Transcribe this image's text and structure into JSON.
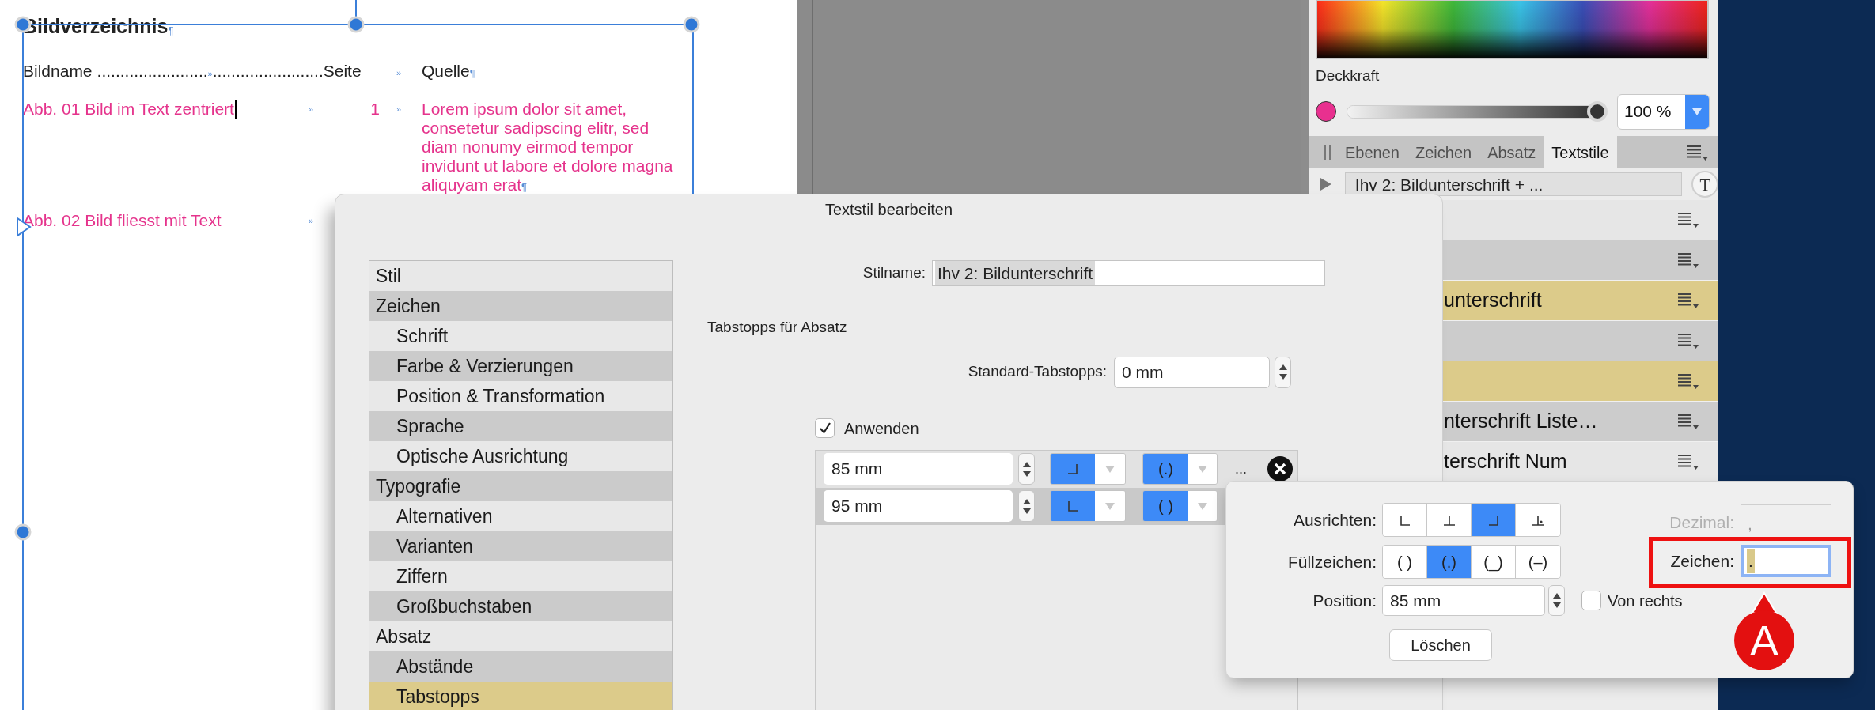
{
  "document": {
    "title": "Bildverzeichnis",
    "title_mark": "¶",
    "header": {
      "name": "Bildname",
      "leader_before": "........................",
      "tab_mark": "»",
      "leader_after": "........................",
      "page": "Seite",
      "page_tab_mark": "»",
      "source": "Quelle",
      "end_mark": "¶"
    },
    "entries": [
      {
        "name": "Abb. 01 Bild im Text zentriert",
        "cursor": true,
        "tab_mark": "»",
        "page": "1",
        "page_tab_mark": "»",
        "source_lines": [
          "Lorem ipsum dolor sit amet,",
          "consetetur sadipscing elitr, sed",
          "diam nonumy eirmod tempor",
          "invidunt ut labore et dolore magna",
          "aliquyam erat"
        ],
        "end_mark": "¶"
      },
      {
        "name": "Abb. 02 Bild fliesst mit Text",
        "cursor": false,
        "tab_mark": "»"
      }
    ]
  },
  "color_panel": {
    "opacity_label": "Deckkraft",
    "color": "#e8308f",
    "level": 1,
    "opacity_value": "100 %"
  },
  "panel_tabs": [
    {
      "label": "Ebenen",
      "selected": false
    },
    {
      "label": "Zeichen",
      "selected": false
    },
    {
      "label": "Absatz",
      "selected": false
    },
    {
      "label": "Textstile",
      "selected": true
    }
  ],
  "style_selector": {
    "value": "Ihv 2: Bildunterschrift + ...",
    "icon_letter": "T"
  },
  "style_rows": [
    {
      "highlighted": false
    },
    {
      "highlighted": false
    },
    {
      "text": "unterschrift",
      "highlighted": true
    },
    {
      "highlighted": false
    },
    {
      "highlighted": true
    },
    {
      "text": "nterschrift Liste…",
      "highlighted": false
    },
    {
      "text": "terschrift Num",
      "highlighted": false
    }
  ],
  "dialog": {
    "title": "Textstil bearbeiten",
    "categories": [
      {
        "label": "Stil",
        "selected": false
      },
      {
        "label": "Zeichen",
        "selected": false,
        "children": [
          {
            "label": "Schrift",
            "selected": false
          },
          {
            "label": "Farbe & Verzierungen",
            "selected": false
          },
          {
            "label": "Position & Transformation",
            "selected": false
          },
          {
            "label": "Sprache",
            "selected": false
          },
          {
            "label": "Optische Ausrichtung",
            "selected": false
          }
        ]
      },
      {
        "label": "Typografie",
        "selected": false,
        "children": [
          {
            "label": "Alternativen",
            "selected": false
          },
          {
            "label": "Varianten",
            "selected": false
          },
          {
            "label": "Ziffern",
            "selected": false
          },
          {
            "label": "Großbuchstaben",
            "selected": false
          }
        ]
      },
      {
        "label": "Absatz",
        "selected": false,
        "children": [
          {
            "label": "Abstände",
            "selected": false
          },
          {
            "label": "Tabstopps",
            "selected": true
          }
        ]
      }
    ],
    "style_name_label": "Stilname:",
    "style_name": "Ihv 2: Bildunterschrift",
    "section_title": "Tabstopps für Absatz",
    "default_tabs_label": "Standard-Tabstopps:",
    "default_tabs": "0 mm",
    "apply": {
      "label": "Anwenden",
      "checked": true
    },
    "tab_stops": [
      {
        "position": "85 mm",
        "alignment": {
          "kind": "right"
        },
        "leader": "(.)",
        "more": "..."
      },
      {
        "position": "95 mm",
        "alignment": {
          "kind": "left"
        },
        "leader": "( )"
      }
    ]
  },
  "popover": {
    "align_label": "Ausrichten:",
    "align_options": [
      {
        "kind": "left",
        "selected": false
      },
      {
        "kind": "center",
        "selected": false
      },
      {
        "kind": "right",
        "selected": true
      },
      {
        "kind": "decimal",
        "selected": false
      }
    ],
    "leader_label": "Füllzeichen:",
    "leader_options": [
      {
        "text": "( )",
        "selected": false
      },
      {
        "text": "(.)",
        "selected": true
      },
      {
        "text": "(_)",
        "selected": false
      },
      {
        "text": "(–)",
        "selected": false
      }
    ],
    "position_label": "Position:",
    "position": "85 mm",
    "from_right": {
      "label": "Von rechts",
      "checked": false
    },
    "delete_button": "Löschen",
    "decimal": {
      "label": "Dezimal:",
      "value": ",",
      "disabled": true
    },
    "character": {
      "label": "Zeichen:",
      "value": ".",
      "focused": true
    }
  },
  "annotation": {
    "label": "A"
  }
}
